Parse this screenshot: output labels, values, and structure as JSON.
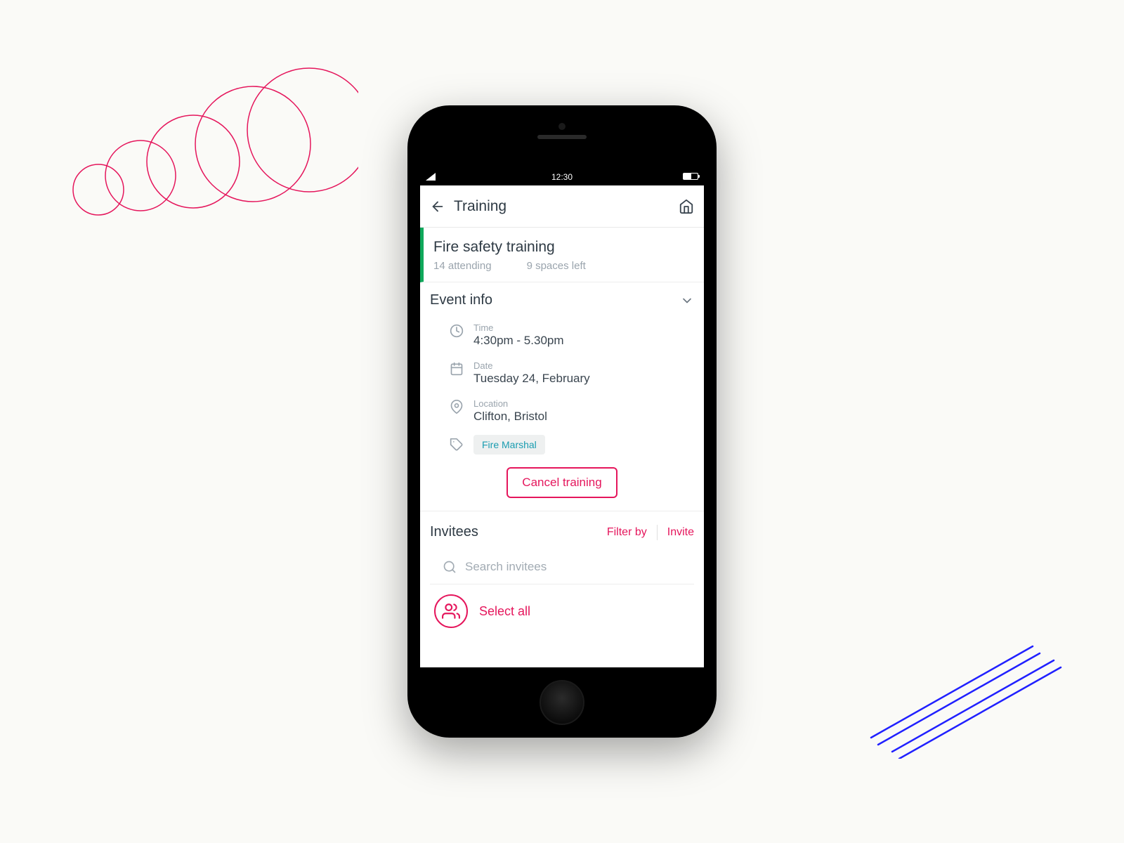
{
  "statusbar": {
    "time": "12:30"
  },
  "header": {
    "title": "Training"
  },
  "training": {
    "name": "Fire safety training",
    "attending": "14 attending",
    "spaces": "9 spaces left"
  },
  "eventInfo": {
    "title": "Event info",
    "timeLabel": "Time",
    "timeValue": "4:30pm - 5.30pm",
    "dateLabel": "Date",
    "dateValue": "Tuesday 24, February",
    "locationLabel": "Location",
    "locationValue": "Clifton, Bristol",
    "tag": "Fire Marshal",
    "cancel": "Cancel training"
  },
  "invitees": {
    "title": "Invitees",
    "filterBy": "Filter by",
    "invite": "Invite",
    "searchPlaceholder": "Search invitees",
    "selectAll": "Select all"
  },
  "colors": {
    "pink": "#e5165c",
    "teal": "#1a9cb0",
    "green": "#0fa85b",
    "blue": "#2020ff",
    "text": "#2e3a44",
    "muted": "#9aa4ad"
  }
}
